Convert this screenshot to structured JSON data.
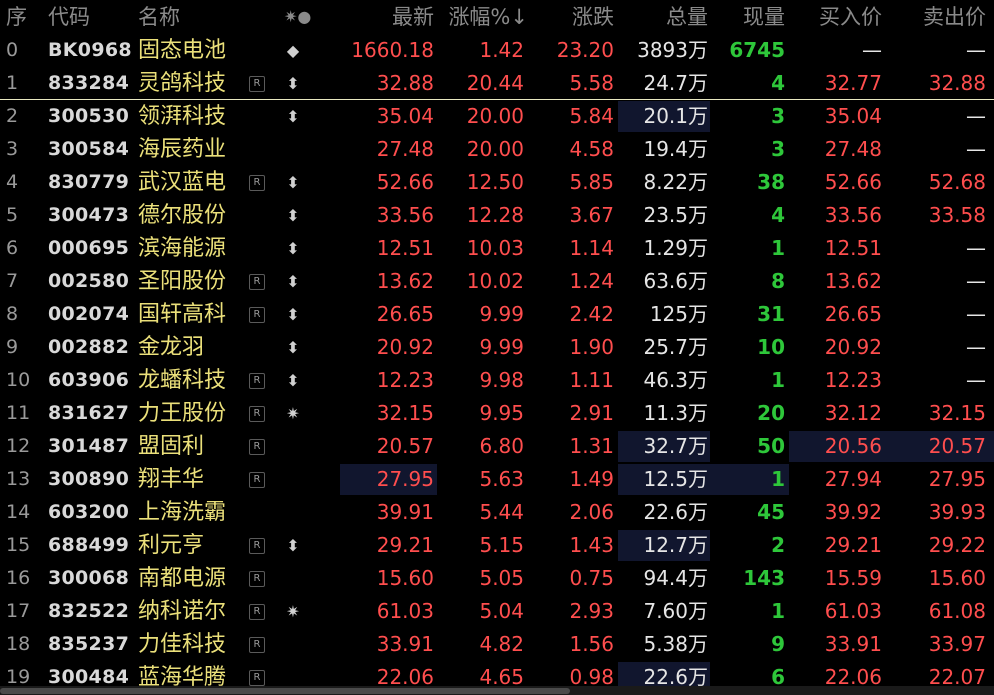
{
  "columns": {
    "idx": "序",
    "code": "代码",
    "name": "名称",
    "mark": "✷●",
    "last": "最新",
    "pct": "涨幅%↓",
    "chg": "涨跌",
    "vol": "总量",
    "cur": "现量",
    "bid": "买入价",
    "ask": "卖出价"
  },
  "rows": [
    {
      "idx": "0",
      "code": "BK0968",
      "name": "固态电池",
      "flag": "",
      "mark": "◆",
      "last": "1660.18",
      "pct": "1.42",
      "chg": "23.20",
      "vol": "3893万",
      "cur": "6745",
      "bid": "—",
      "ask": "—"
    },
    {
      "idx": "1",
      "code": "833284",
      "name": "灵鸽科技",
      "flag": "R",
      "mark": "⬍",
      "last": "32.88",
      "pct": "20.44",
      "chg": "5.58",
      "vol": "24.7万",
      "cur": "4",
      "bid": "32.77",
      "ask": "32.88"
    },
    {
      "idx": "2",
      "code": "300530",
      "name": "领湃科技",
      "flag": "",
      "mark": "⬍",
      "last": "35.04",
      "pct": "20.00",
      "chg": "5.84",
      "vol": "20.1万",
      "cur": "3",
      "bid": "35.04",
      "ask": "—"
    },
    {
      "idx": "3",
      "code": "300584",
      "name": "海辰药业",
      "flag": "",
      "mark": "",
      "last": "27.48",
      "pct": "20.00",
      "chg": "4.58",
      "vol": "19.4万",
      "cur": "3",
      "bid": "27.48",
      "ask": "—"
    },
    {
      "idx": "4",
      "code": "830779",
      "name": "武汉蓝电",
      "flag": "R",
      "mark": "⬍",
      "last": "52.66",
      "pct": "12.50",
      "chg": "5.85",
      "vol": "8.22万",
      "cur": "38",
      "bid": "52.66",
      "ask": "52.68"
    },
    {
      "idx": "5",
      "code": "300473",
      "name": "德尔股份",
      "flag": "",
      "mark": "⬍",
      "last": "33.56",
      "pct": "12.28",
      "chg": "3.67",
      "vol": "23.5万",
      "cur": "4",
      "bid": "33.56",
      "ask": "33.58"
    },
    {
      "idx": "6",
      "code": "000695",
      "name": "滨海能源",
      "flag": "",
      "mark": "⬍",
      "last": "12.51",
      "pct": "10.03",
      "chg": "1.14",
      "vol": "1.29万",
      "cur": "1",
      "bid": "12.51",
      "ask": "—"
    },
    {
      "idx": "7",
      "code": "002580",
      "name": "圣阳股份",
      "flag": "R",
      "mark": "⬍",
      "last": "13.62",
      "pct": "10.02",
      "chg": "1.24",
      "vol": "63.6万",
      "cur": "8",
      "bid": "13.62",
      "ask": "—"
    },
    {
      "idx": "8",
      "code": "002074",
      "name": "国轩高科",
      "flag": "R",
      "mark": "⬍",
      "last": "26.65",
      "pct": "9.99",
      "chg": "2.42",
      "vol": "125万",
      "cur": "31",
      "bid": "26.65",
      "ask": "—"
    },
    {
      "idx": "9",
      "code": "002882",
      "name": "金龙羽",
      "flag": "",
      "mark": "⬍",
      "last": "20.92",
      "pct": "9.99",
      "chg": "1.90",
      "vol": "25.7万",
      "cur": "10",
      "bid": "20.92",
      "ask": "—"
    },
    {
      "idx": "10",
      "code": "603906",
      "name": "龙蟠科技",
      "flag": "R",
      "mark": "⬍",
      "last": "12.23",
      "pct": "9.98",
      "chg": "1.11",
      "vol": "46.3万",
      "cur": "1",
      "bid": "12.23",
      "ask": "—"
    },
    {
      "idx": "11",
      "code": "831627",
      "name": "力王股份",
      "flag": "R",
      "mark": "✷",
      "last": "32.15",
      "pct": "9.95",
      "chg": "2.91",
      "vol": "11.3万",
      "cur": "20",
      "bid": "32.12",
      "ask": "32.15"
    },
    {
      "idx": "12",
      "code": "301487",
      "name": "盟固利",
      "flag": "R",
      "mark": "",
      "last": "20.57",
      "pct": "6.80",
      "chg": "1.31",
      "vol": "32.7万",
      "cur": "50",
      "bid": "20.56",
      "ask": "20.57"
    },
    {
      "idx": "13",
      "code": "300890",
      "name": "翔丰华",
      "flag": "R",
      "mark": "",
      "last": "27.95",
      "pct": "5.63",
      "chg": "1.49",
      "vol": "12.5万",
      "cur": "1",
      "bid": "27.94",
      "ask": "27.95"
    },
    {
      "idx": "14",
      "code": "603200",
      "name": "上海洗霸",
      "flag": "",
      "mark": "",
      "last": "39.91",
      "pct": "5.44",
      "chg": "2.06",
      "vol": "22.6万",
      "cur": "45",
      "bid": "39.92",
      "ask": "39.93"
    },
    {
      "idx": "15",
      "code": "688499",
      "name": "利元亨",
      "flag": "R",
      "mark": "⬍",
      "last": "29.21",
      "pct": "5.15",
      "chg": "1.43",
      "vol": "12.7万",
      "cur": "2",
      "bid": "29.21",
      "ask": "29.22"
    },
    {
      "idx": "16",
      "code": "300068",
      "name": "南都电源",
      "flag": "R",
      "mark": "",
      "last": "15.60",
      "pct": "5.05",
      "chg": "0.75",
      "vol": "94.4万",
      "cur": "143",
      "bid": "15.59",
      "ask": "15.60"
    },
    {
      "idx": "17",
      "code": "832522",
      "name": "纳科诺尔",
      "flag": "R",
      "mark": "✷",
      "last": "61.03",
      "pct": "5.04",
      "chg": "2.93",
      "vol": "7.60万",
      "cur": "1",
      "bid": "61.03",
      "ask": "61.08"
    },
    {
      "idx": "18",
      "code": "835237",
      "name": "力佳科技",
      "flag": "R",
      "mark": "",
      "last": "33.91",
      "pct": "4.82",
      "chg": "1.56",
      "vol": "5.38万",
      "cur": "9",
      "bid": "33.91",
      "ask": "33.97"
    },
    {
      "idx": "19",
      "code": "300484",
      "name": "蓝海华腾",
      "flag": "R",
      "mark": "",
      "last": "22.06",
      "pct": "4.65",
      "chg": "0.98",
      "vol": "22.6万",
      "cur": "6",
      "bid": "22.06",
      "ask": "22.07"
    }
  ]
}
